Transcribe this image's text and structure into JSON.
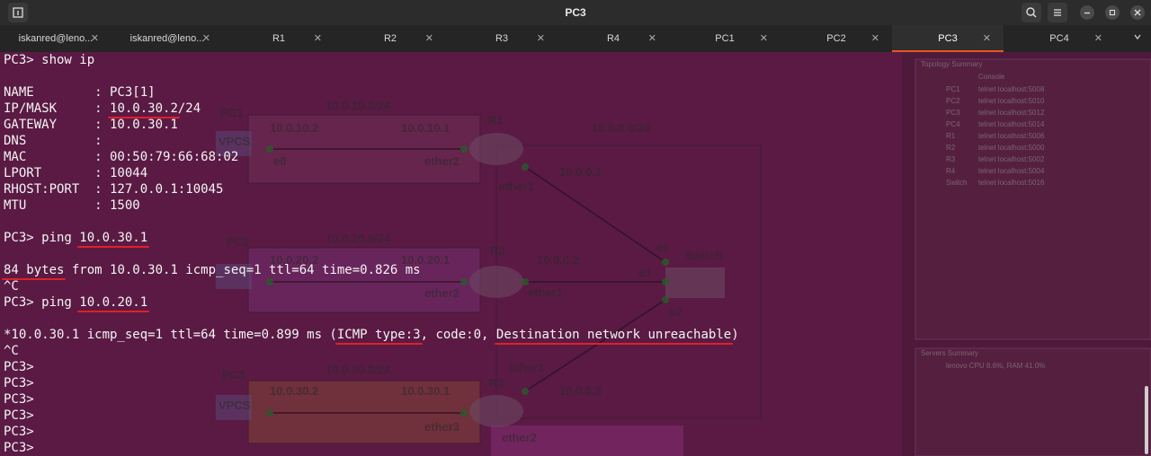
{
  "window": {
    "title": "PC3",
    "left_icon": "terminal-tab-icon",
    "right_icons": [
      "search-icon",
      "menu-icon",
      "minimize-icon",
      "restore-icon",
      "close-icon"
    ]
  },
  "tabs": [
    {
      "label": "iskanred@leno...",
      "closable": true,
      "active": false
    },
    {
      "label": "iskanred@leno...",
      "closable": true,
      "active": false
    },
    {
      "label": "R1",
      "closable": true,
      "active": false
    },
    {
      "label": "R2",
      "closable": true,
      "active": false
    },
    {
      "label": "R3",
      "closable": true,
      "active": false
    },
    {
      "label": "R4",
      "closable": true,
      "active": false
    },
    {
      "label": "PC1",
      "closable": true,
      "active": false
    },
    {
      "label": "PC2",
      "closable": true,
      "active": false
    },
    {
      "label": "PC3",
      "closable": true,
      "active": true
    },
    {
      "label": "PC4",
      "closable": true,
      "active": false
    }
  ],
  "tab_overflow_icon": "chevron-down-icon",
  "terminal": {
    "background": "#5a1a44",
    "highlight_color": "#e0202a",
    "lines": [
      [
        {
          "t": "PC3> show ip"
        }
      ],
      [
        {
          "t": ""
        }
      ],
      [
        {
          "t": "NAME        : PC3[1]"
        }
      ],
      [
        {
          "t": "IP/MASK     : "
        },
        {
          "t": "10.0.30.2",
          "hl": true
        },
        {
          "t": "/24"
        }
      ],
      [
        {
          "t": "GATEWAY     : 10.0.30.1"
        }
      ],
      [
        {
          "t": "DNS         :"
        }
      ],
      [
        {
          "t": "MAC         : 00:50:79:66:68:02"
        }
      ],
      [
        {
          "t": "LPORT       : 10044"
        }
      ],
      [
        {
          "t": "RHOST:PORT  : 127.0.0.1:10045"
        }
      ],
      [
        {
          "t": "MTU         : 1500"
        }
      ],
      [
        {
          "t": ""
        }
      ],
      [
        {
          "t": "PC3> ping "
        },
        {
          "t": "10.0.30.1",
          "hl": true
        }
      ],
      [
        {
          "t": ""
        }
      ],
      [
        {
          "t": "84 bytes",
          "hl": true
        },
        {
          "t": " from 10.0.30.1 icmp_seq=1 ttl=64 time=0.826 ms"
        }
      ],
      [
        {
          "t": "^C"
        }
      ],
      [
        {
          "t": "PC3> ping "
        },
        {
          "t": "10.0.20.1",
          "hl": true
        }
      ],
      [
        {
          "t": ""
        }
      ],
      [
        {
          "t": "*10.0.30.1 icmp_seq=1 ttl=64 time=0.899 ms ("
        },
        {
          "t": "ICMP type:3",
          "hl": true
        },
        {
          "t": ", code:0, "
        },
        {
          "t": "Destination network unreachable",
          "hl": true
        },
        {
          "t": ")"
        }
      ],
      [
        {
          "t": "^C"
        }
      ],
      [
        {
          "t": "PC3>"
        }
      ],
      [
        {
          "t": "PC3>"
        }
      ],
      [
        {
          "t": "PC3>"
        }
      ],
      [
        {
          "t": "PC3>"
        }
      ],
      [
        {
          "t": "PC3>"
        }
      ],
      [
        {
          "t": "PC3>"
        }
      ]
    ]
  },
  "background_topology": {
    "subnets": [
      "10.0.10.0/24",
      "10.0.20.0/24",
      "10.0.30.0/24",
      "10.0.0.0/24"
    ],
    "nodes": [
      "PC1",
      "PC2",
      "PC3",
      "R1",
      "R2",
      "R3",
      "Switch"
    ],
    "labels": [
      "10.0.10.2",
      "10.0.10.1",
      "10.0.20.2",
      "10.0.20.1",
      "10.0.30.2",
      "10.0.30.1",
      "10.0.0.1",
      "10.0.0.2",
      "10.0.0.3",
      "e0",
      "e1",
      "e2",
      "ether1",
      "ether2",
      "ether3",
      "VPCS"
    ],
    "summary_title": "Topology Summary",
    "summary_col": "Console",
    "summary_rows": [
      {
        "node": "PC1",
        "console": "telnet localhost:5008"
      },
      {
        "node": "PC2",
        "console": "telnet localhost:5010"
      },
      {
        "node": "PC3",
        "console": "telnet localhost:5012"
      },
      {
        "node": "PC4",
        "console": "telnet localhost:5014"
      },
      {
        "node": "R1",
        "console": "telnet localhost:5006"
      },
      {
        "node": "R2",
        "console": "telnet localhost:5000"
      },
      {
        "node": "R3",
        "console": "telnet localhost:5002"
      },
      {
        "node": "R4",
        "console": "telnet localhost:5004"
      },
      {
        "node": "Switch",
        "console": "telnet localhost:5016"
      }
    ],
    "servers_title": "Servers Summary",
    "servers_row": "lenovo CPU 8.6%, RAM 41.0%"
  }
}
